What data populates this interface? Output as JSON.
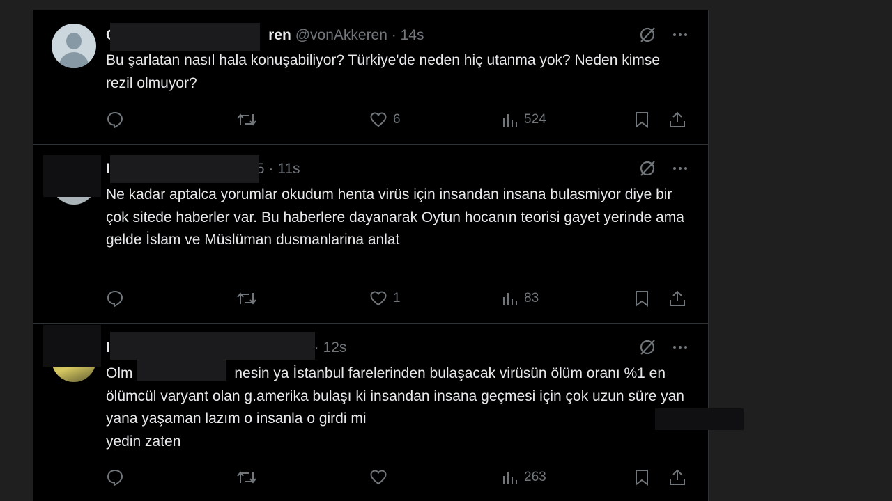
{
  "tweets": [
    {
      "name_visible": "C",
      "name_tail": "ren",
      "handle": "@vonAkkeren",
      "time": "14s",
      "text": "Bu şarlatan nasıl hala konuşabiliyor? Türkiye'de neden hiç utanma yok? Neden kimse rezil olmuyor?",
      "likes": "6",
      "views": "524"
    },
    {
      "name_visible": "I",
      "name_tail": "5",
      "time": "11s",
      "text": "Ne kadar aptalca yorumlar okudum henta virüs için insandan insana bulasmiyor diye bir çok sitede haberler var. Bu haberlere dayanarak Oytun hocanın teorisi gayet yerinde ama gelde İslam ve Müslüman dusmanlarina anlat",
      "likes": "1",
      "views": "83"
    },
    {
      "name_visible": "I",
      "time": "12s",
      "text_start": "Olm",
      "text_rest": " nesin ya İstanbul farelerinden bulaşacak virüsün ölüm oranı %1 en ölümcül varyant olan g.amerika bulaşı ki insandan insana geçmesi için çok uzun süre yan yana yaşaman lazım o insanla o girdi mi",
      "text_end": "yedin zaten",
      "views": "263"
    }
  ],
  "separator": " · ",
  "icons": {
    "grok": "grok-icon",
    "more": "more-icon",
    "reply": "reply-icon",
    "retweet": "retweet-icon",
    "like": "heart-icon",
    "views": "views-icon",
    "bookmark": "bookmark-icon",
    "share": "share-icon"
  },
  "colors": {
    "text": "#e7e9ea",
    "muted": "#71767b",
    "background": "#000000",
    "border": "#2f3336"
  }
}
